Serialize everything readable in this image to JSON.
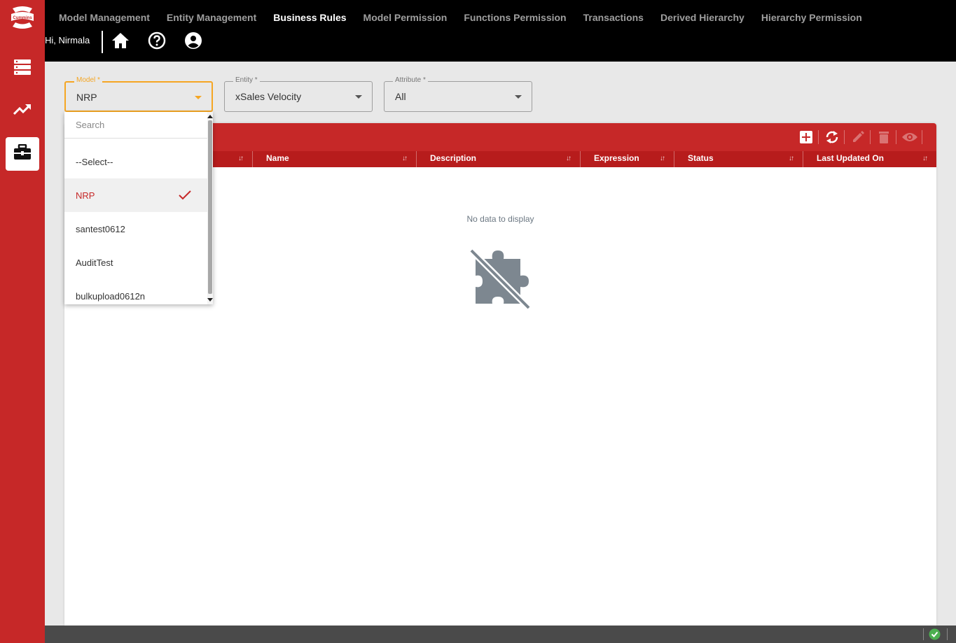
{
  "brand": {
    "logo_text": "Cummins",
    "accent": "#c62828"
  },
  "sidebar": {
    "items": [
      {
        "name": "database",
        "icon": "database-icon",
        "active": false
      },
      {
        "name": "analytics",
        "icon": "trending-up-icon",
        "active": false
      },
      {
        "name": "business",
        "icon": "briefcase-icon",
        "active": true
      }
    ]
  },
  "topnav": {
    "items": [
      {
        "label": "Model Management",
        "active": false
      },
      {
        "label": "Entity Management",
        "active": false
      },
      {
        "label": "Business Rules",
        "active": true
      },
      {
        "label": "Model Permission",
        "active": false
      },
      {
        "label": "Functions Permission",
        "active": false
      },
      {
        "label": "Transactions",
        "active": false
      },
      {
        "label": "Derived Hierarchy",
        "active": false
      },
      {
        "label": "Hierarchy Permission",
        "active": false
      }
    ],
    "greeting": "Hi, Nirmala",
    "icons": [
      "home-icon",
      "help-icon",
      "account-icon"
    ]
  },
  "filters": {
    "model": {
      "label": "Model *",
      "value": "NRP"
    },
    "entity": {
      "label": "Entity *",
      "value": "xSales Velocity"
    },
    "attribute": {
      "label": "Attribute *",
      "value": "All"
    }
  },
  "dropdown": {
    "search_placeholder": "Search",
    "options": [
      {
        "label": "--Select--",
        "selected": false
      },
      {
        "label": "NRP",
        "selected": true
      },
      {
        "label": "santest0612",
        "selected": false
      },
      {
        "label": "AuditTest",
        "selected": false
      },
      {
        "label": "bulkupload0612n",
        "selected": false
      }
    ]
  },
  "grid": {
    "toolbar_icons": [
      "add-icon",
      "refresh-icon",
      "edit-icon",
      "delete-icon",
      "view-icon"
    ],
    "columns": [
      "",
      "Name",
      "Description",
      "Expression",
      "Status",
      "Last Updated On"
    ],
    "empty_message": "No data to display"
  },
  "status": {
    "ok_color": "#4caf50"
  }
}
